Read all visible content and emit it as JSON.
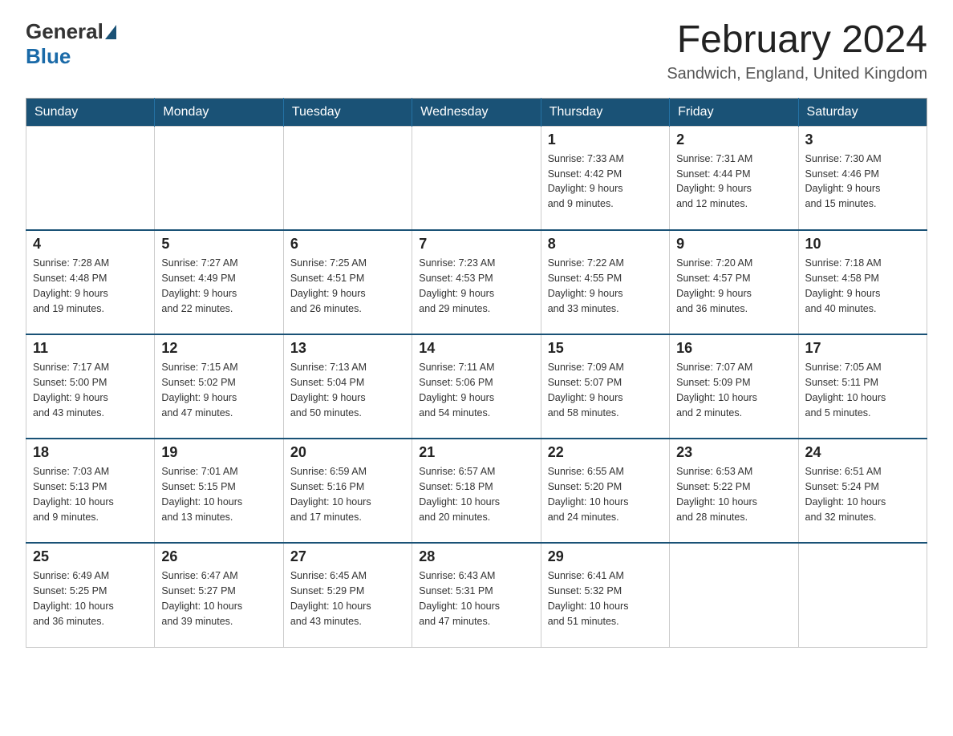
{
  "header": {
    "logo_general": "General",
    "logo_blue": "Blue",
    "month_title": "February 2024",
    "location": "Sandwich, England, United Kingdom"
  },
  "days_of_week": [
    "Sunday",
    "Monday",
    "Tuesday",
    "Wednesday",
    "Thursday",
    "Friday",
    "Saturday"
  ],
  "weeks": [
    {
      "days": [
        {
          "number": "",
          "info": ""
        },
        {
          "number": "",
          "info": ""
        },
        {
          "number": "",
          "info": ""
        },
        {
          "number": "",
          "info": ""
        },
        {
          "number": "1",
          "info": "Sunrise: 7:33 AM\nSunset: 4:42 PM\nDaylight: 9 hours\nand 9 minutes."
        },
        {
          "number": "2",
          "info": "Sunrise: 7:31 AM\nSunset: 4:44 PM\nDaylight: 9 hours\nand 12 minutes."
        },
        {
          "number": "3",
          "info": "Sunrise: 7:30 AM\nSunset: 4:46 PM\nDaylight: 9 hours\nand 15 minutes."
        }
      ]
    },
    {
      "days": [
        {
          "number": "4",
          "info": "Sunrise: 7:28 AM\nSunset: 4:48 PM\nDaylight: 9 hours\nand 19 minutes."
        },
        {
          "number": "5",
          "info": "Sunrise: 7:27 AM\nSunset: 4:49 PM\nDaylight: 9 hours\nand 22 minutes."
        },
        {
          "number": "6",
          "info": "Sunrise: 7:25 AM\nSunset: 4:51 PM\nDaylight: 9 hours\nand 26 minutes."
        },
        {
          "number": "7",
          "info": "Sunrise: 7:23 AM\nSunset: 4:53 PM\nDaylight: 9 hours\nand 29 minutes."
        },
        {
          "number": "8",
          "info": "Sunrise: 7:22 AM\nSunset: 4:55 PM\nDaylight: 9 hours\nand 33 minutes."
        },
        {
          "number": "9",
          "info": "Sunrise: 7:20 AM\nSunset: 4:57 PM\nDaylight: 9 hours\nand 36 minutes."
        },
        {
          "number": "10",
          "info": "Sunrise: 7:18 AM\nSunset: 4:58 PM\nDaylight: 9 hours\nand 40 minutes."
        }
      ]
    },
    {
      "days": [
        {
          "number": "11",
          "info": "Sunrise: 7:17 AM\nSunset: 5:00 PM\nDaylight: 9 hours\nand 43 minutes."
        },
        {
          "number": "12",
          "info": "Sunrise: 7:15 AM\nSunset: 5:02 PM\nDaylight: 9 hours\nand 47 minutes."
        },
        {
          "number": "13",
          "info": "Sunrise: 7:13 AM\nSunset: 5:04 PM\nDaylight: 9 hours\nand 50 minutes."
        },
        {
          "number": "14",
          "info": "Sunrise: 7:11 AM\nSunset: 5:06 PM\nDaylight: 9 hours\nand 54 minutes."
        },
        {
          "number": "15",
          "info": "Sunrise: 7:09 AM\nSunset: 5:07 PM\nDaylight: 9 hours\nand 58 minutes."
        },
        {
          "number": "16",
          "info": "Sunrise: 7:07 AM\nSunset: 5:09 PM\nDaylight: 10 hours\nand 2 minutes."
        },
        {
          "number": "17",
          "info": "Sunrise: 7:05 AM\nSunset: 5:11 PM\nDaylight: 10 hours\nand 5 minutes."
        }
      ]
    },
    {
      "days": [
        {
          "number": "18",
          "info": "Sunrise: 7:03 AM\nSunset: 5:13 PM\nDaylight: 10 hours\nand 9 minutes."
        },
        {
          "number": "19",
          "info": "Sunrise: 7:01 AM\nSunset: 5:15 PM\nDaylight: 10 hours\nand 13 minutes."
        },
        {
          "number": "20",
          "info": "Sunrise: 6:59 AM\nSunset: 5:16 PM\nDaylight: 10 hours\nand 17 minutes."
        },
        {
          "number": "21",
          "info": "Sunrise: 6:57 AM\nSunset: 5:18 PM\nDaylight: 10 hours\nand 20 minutes."
        },
        {
          "number": "22",
          "info": "Sunrise: 6:55 AM\nSunset: 5:20 PM\nDaylight: 10 hours\nand 24 minutes."
        },
        {
          "number": "23",
          "info": "Sunrise: 6:53 AM\nSunset: 5:22 PM\nDaylight: 10 hours\nand 28 minutes."
        },
        {
          "number": "24",
          "info": "Sunrise: 6:51 AM\nSunset: 5:24 PM\nDaylight: 10 hours\nand 32 minutes."
        }
      ]
    },
    {
      "days": [
        {
          "number": "25",
          "info": "Sunrise: 6:49 AM\nSunset: 5:25 PM\nDaylight: 10 hours\nand 36 minutes."
        },
        {
          "number": "26",
          "info": "Sunrise: 6:47 AM\nSunset: 5:27 PM\nDaylight: 10 hours\nand 39 minutes."
        },
        {
          "number": "27",
          "info": "Sunrise: 6:45 AM\nSunset: 5:29 PM\nDaylight: 10 hours\nand 43 minutes."
        },
        {
          "number": "28",
          "info": "Sunrise: 6:43 AM\nSunset: 5:31 PM\nDaylight: 10 hours\nand 47 minutes."
        },
        {
          "number": "29",
          "info": "Sunrise: 6:41 AM\nSunset: 5:32 PM\nDaylight: 10 hours\nand 51 minutes."
        },
        {
          "number": "",
          "info": ""
        },
        {
          "number": "",
          "info": ""
        }
      ]
    }
  ]
}
